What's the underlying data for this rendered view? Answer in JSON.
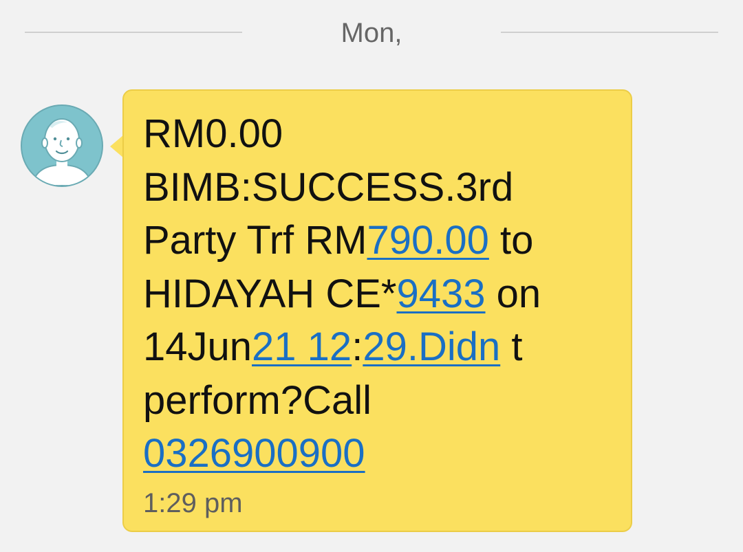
{
  "date_divider": {
    "label": "Mon,"
  },
  "message": {
    "sender_avatar": "person-avatar-icon",
    "lines": [
      [
        {
          "text": "RM0.00"
        }
      ],
      [
        {
          "text": "BIMB:SUCCESS.3rd"
        }
      ],
      [
        {
          "text": "Party Trf RM"
        },
        {
          "text": "790.00",
          "link": true
        },
        {
          "text": " to"
        }
      ],
      [
        {
          "text": "HIDAYAH CE*"
        },
        {
          "text": "9433",
          "link": true
        },
        {
          "text": " on"
        }
      ],
      [
        {
          "text": "14Jun"
        },
        {
          "text": "21 12",
          "link": true
        },
        {
          "text": ":"
        },
        {
          "text": "29.Didn",
          "link": true
        },
        {
          "text": " t"
        }
      ],
      [
        {
          "text": "perform?Call"
        }
      ],
      [
        {
          "text": "0326900900",
          "link": true
        }
      ]
    ],
    "timestamp": "1:29 pm"
  },
  "colors": {
    "bubble": "#fbe05f",
    "link": "#1a6fc4",
    "background": "#f2f2f2"
  }
}
